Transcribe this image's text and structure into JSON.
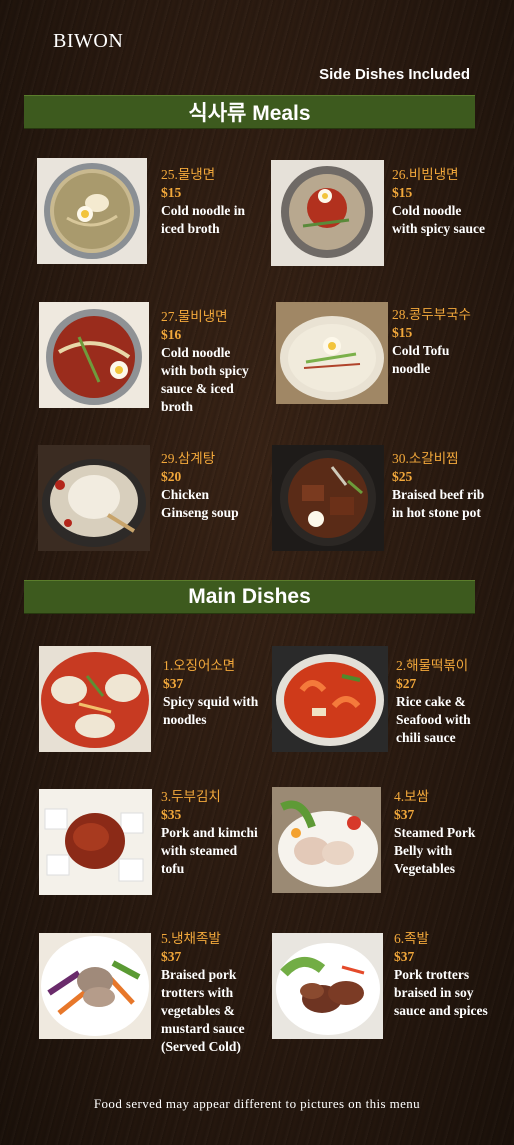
{
  "brand": "BIWON",
  "side_note": "Side Dishes Included",
  "sections": {
    "meals": "식사류 Meals",
    "main": "Main Dishes"
  },
  "meals": [
    {
      "name": "25.물냉면",
      "price": "$15",
      "desc": "Cold noodle in iced broth"
    },
    {
      "name": "26.비빔냉면",
      "price": "$15",
      "desc": "Cold noodle with spicy sauce"
    },
    {
      "name": "27.물비냉면",
      "price": "$16",
      "desc": "Cold noodle with both spicy sauce & iced broth"
    },
    {
      "name": "28.콩두부국수",
      "price": "$15",
      "desc": "Cold Tofu noodle"
    },
    {
      "name": "29.삼계탕",
      "price": "$20",
      "desc": "Chicken Ginseng soup"
    },
    {
      "name": "30.소갈비찜",
      "price": "$25",
      "desc": "Braised beef rib in hot stone pot"
    }
  ],
  "main_dishes": [
    {
      "name": "1.오징어소면",
      "price": "$37",
      "desc": "Spicy squid with noodles"
    },
    {
      "name": "2.해물떡볶이",
      "price": "$27",
      "desc": "Rice cake & Seafood with chili sauce"
    },
    {
      "name": "3.두부김치",
      "price": "$35",
      "desc": "Pork and kimchi with steamed tofu"
    },
    {
      "name": "4.보쌈",
      "price": "$37",
      "desc": "Steamed Pork Belly with Vegetables"
    },
    {
      "name": "5.냉채족발",
      "price": "$37",
      "desc": "Braised pork trotters with vegetables & mustard sauce (Served Cold)"
    },
    {
      "name": "6.족발",
      "price": "$37",
      "desc": "Pork trotters braised in soy sauce and spices"
    }
  ],
  "footer": "Food served may appear different to pictures on this menu"
}
